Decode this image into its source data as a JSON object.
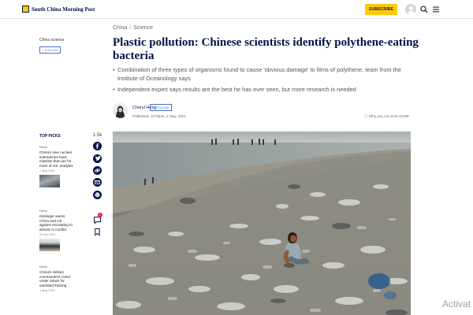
{
  "header": {
    "logo_text": "South China Morning Post",
    "subscribe_label": "SUBSCRIBE"
  },
  "left_rail": {
    "channel": "China science",
    "follow_label": "+ FOLLOW"
  },
  "article": {
    "breadcrumb": [
      "China",
      "Science"
    ],
    "headline": "Plastic pollution: Chinese scientists identify polythene-eating bacteria",
    "bullets": [
      "Combination of three types of organisms found to cause 'obvious damage' to films of polythene, team from the Institute of Oceanology says",
      "Independent expert says results are the best he has ever seen, but more research is needed"
    ],
    "author": {
      "name": "Cheryl Heng",
      "follow_label": "+ FOLLOW",
      "published": "Published: 12:00pm, 2 May, 2021",
      "trust_link": "Why you can trust SCMP"
    }
  },
  "top_picks": {
    "title": "TOP PICKS",
    "items": [
      {
        "tag": "News",
        "title": "China's new nuclear submarines have missiles that can hit more of US: analysts",
        "date": "2 May 2021"
      },
      {
        "tag": "News",
        "title": "Kissinger warns China and US against escalating to almost AI conflict",
        "date": "30 Apr 2021"
      },
      {
        "tag": "News",
        "title": "China's military commanders come under attack for outdated training",
        "date": "1 May 2021"
      }
    ]
  },
  "share": {
    "count": "1.5k",
    "buttons": [
      "facebook-icon",
      "twitter-icon",
      "link-icon",
      "email-icon",
      "print-icon"
    ],
    "comment_count": "2"
  },
  "overlay": {
    "watermark": "Activat"
  },
  "colors": {
    "brand_navy": "#001246",
    "brand_yellow": "#ffca05",
    "follow_blue": "#4a6fd3"
  }
}
